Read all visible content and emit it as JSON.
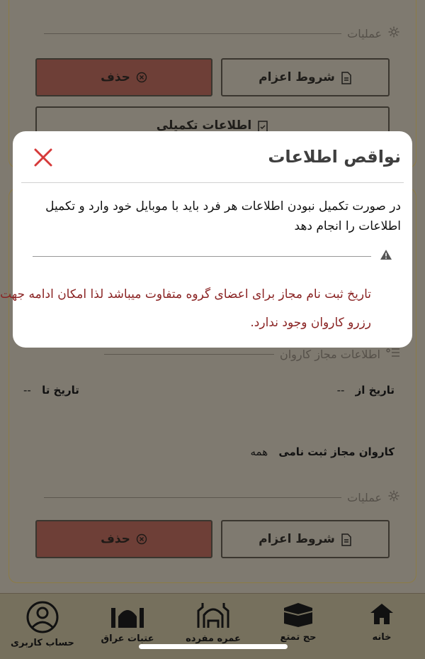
{
  "operations_label": "عملیات",
  "buttons": {
    "delete": "حذف",
    "departure_terms": "شروط اعزام",
    "additional_info": "اطلاعات تکمیلی"
  },
  "caravan": {
    "section_title": "اطلاعات مجاز کاروان",
    "date_from_label": "تاریخ از",
    "date_from_value": "--",
    "date_to_label": "تاریخ تا",
    "date_to_value": "--",
    "allowed_registration_label": "کاروان مجاز ثبت نامی",
    "allowed_registration_value": "همه"
  },
  "modal": {
    "title": "نواقص اطلاعات",
    "message": "در صورت تکمیل نبودن اطلاعات هر فرد باید با موبایل خود وارد و تکمیل اطلاعات را انجام دهد",
    "warning": "تاریخ ثبت نام مجاز برای اعضای گروه متفاوت میباشد لذا امکان ادامه جهت رزرو کاروان وجود ندارد."
  },
  "nav": {
    "home": "خانه",
    "hajj": "حج تمتع",
    "umrah": "عمره مفرده",
    "iraq": "عتبات عراق",
    "account": "حساب کاربری"
  },
  "colors": {
    "accent_gold": "#8c7b45",
    "warning_red": "#8a2323",
    "close_red": "#d63a3a",
    "delete_bg": "#6e3f37"
  }
}
